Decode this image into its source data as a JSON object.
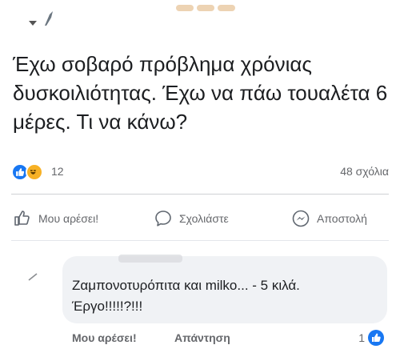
{
  "post": {
    "text": "Έχω σοβαρό πρόβλημα χρόνιας δυσκοιλιότητας. Έχω να πάω τουαλέτα 6 μέρες. Τι να κάνω?"
  },
  "reactions": {
    "count": "12",
    "icons": [
      "like-icon",
      "haha-icon"
    ],
    "comments_label": "48 σχόλια"
  },
  "actions": {
    "like_label": "Μου αρέσει!",
    "comment_label": "Σχολιάστε",
    "send_label": "Αποστολή"
  },
  "comment": {
    "text_line1": "Ζαμπονοτυρόπιτα και milko... - 5 κιλά.",
    "text_line2": "Έργο!!!!!?!!!",
    "like_label": "Μου αρέσει!",
    "reply_label": "Απάντηση",
    "like_count": "1"
  },
  "colors": {
    "accent": "#1877f2",
    "haha": "#f7b125",
    "muted": "#65676b",
    "bubble": "#f0f2f5"
  }
}
